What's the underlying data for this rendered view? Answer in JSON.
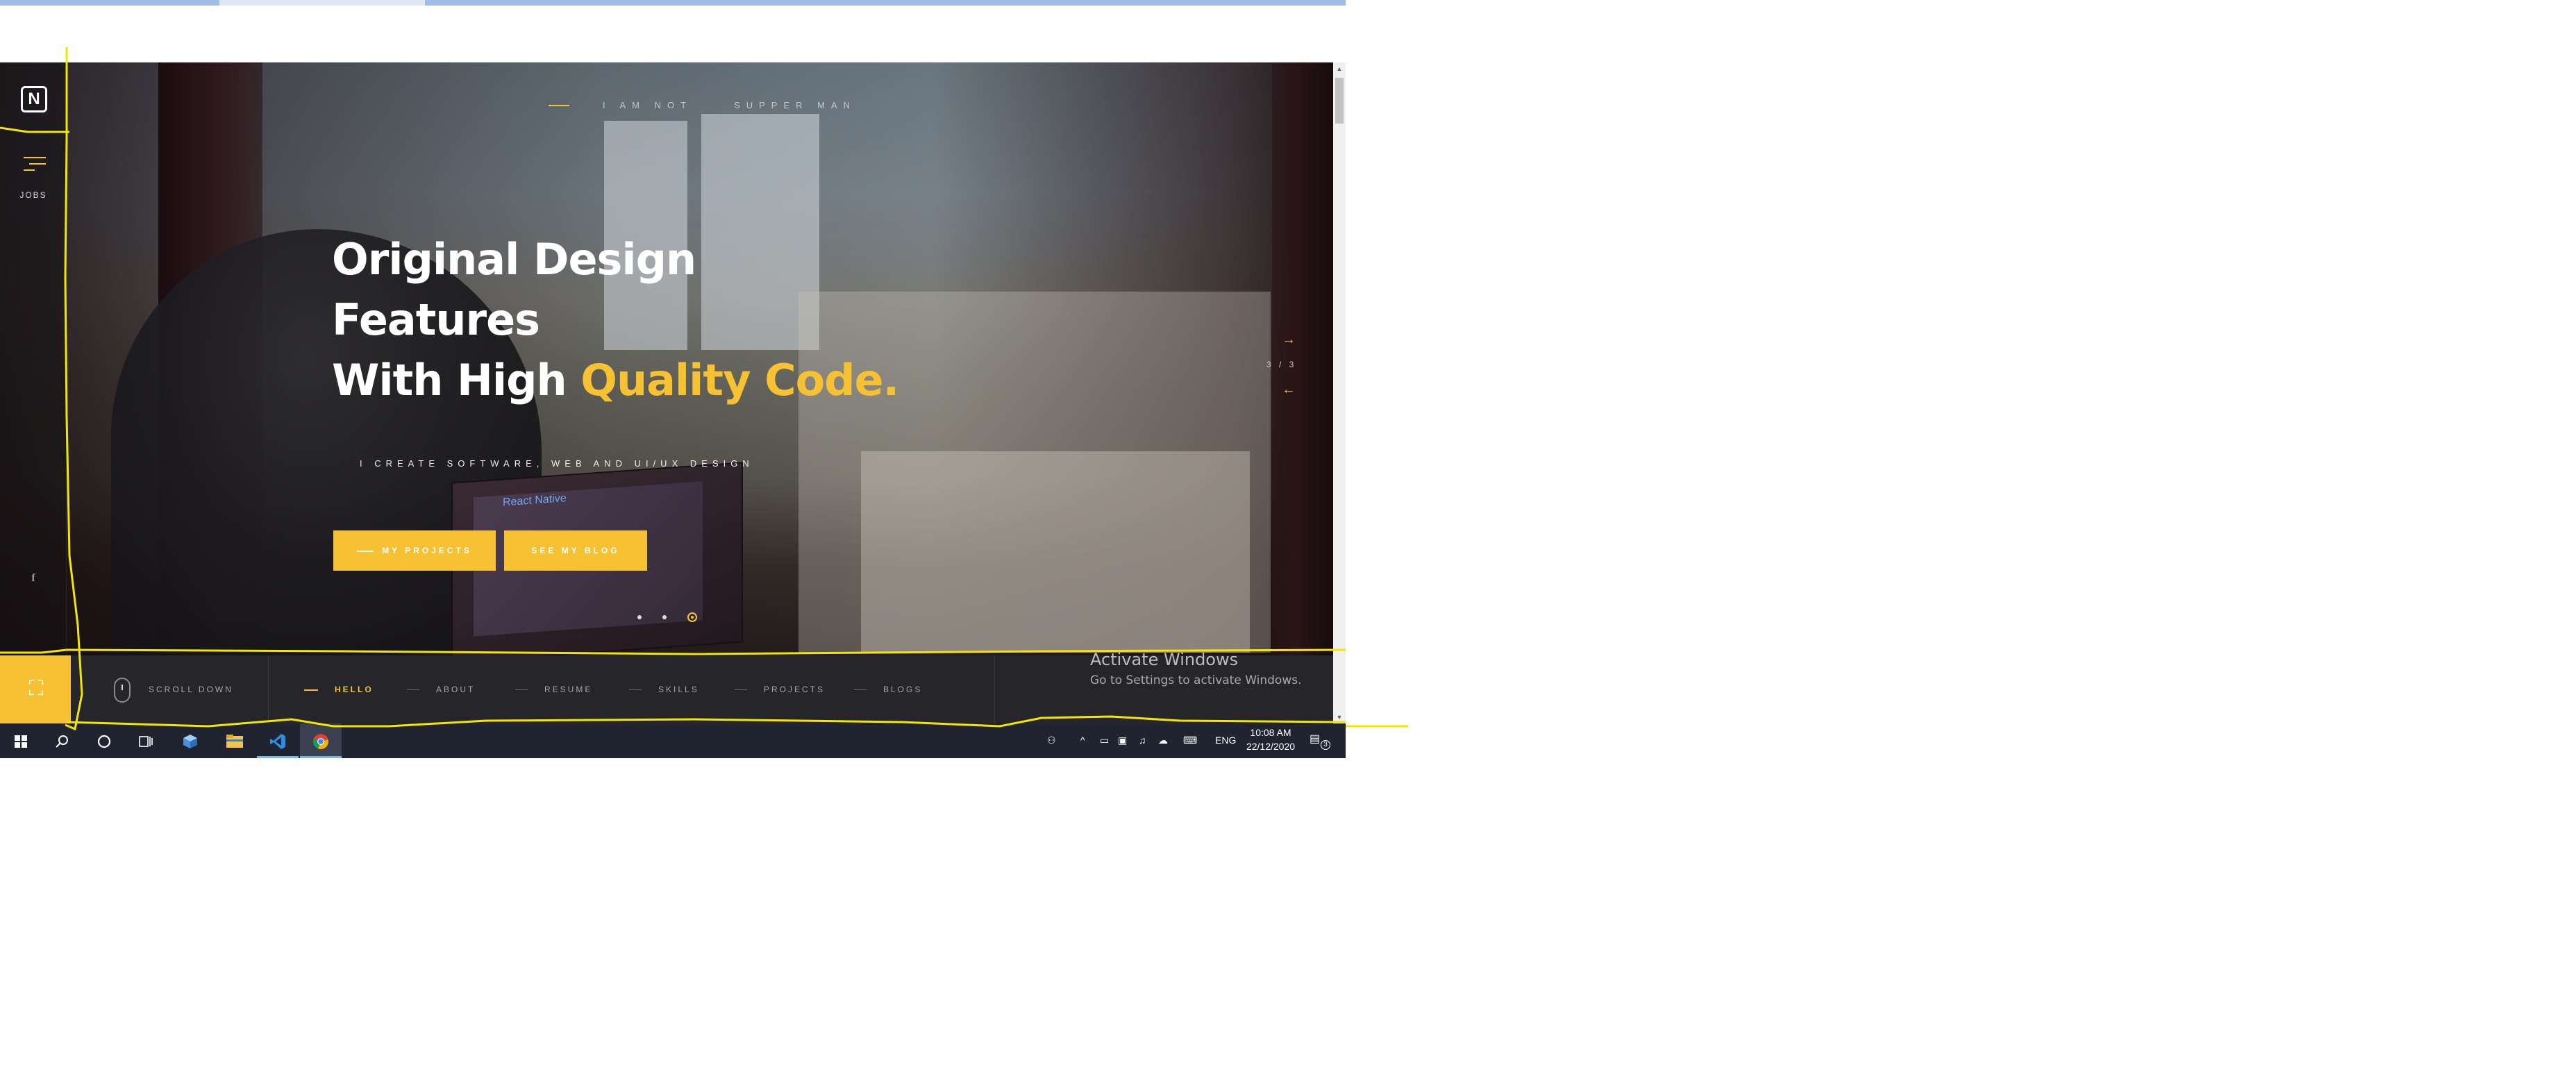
{
  "hero": {
    "tagline_left": "I AM NOT",
    "tagline_right": "SUPPER MAN",
    "headline_line1": "Original Design",
    "headline_line2": "Features",
    "headline_line3_prefix": "With High ",
    "headline_line3_accent": "Quality Code.",
    "subtitle": "I CREATE SOFTWARE, WEB AND UI/UX DESIGN",
    "primary_button": "MY PROJECTS",
    "secondary_button": "SEE MY BLOG",
    "slide_counter": "3 / 3",
    "laptop_screen_title": "React Native"
  },
  "sidebar": {
    "logo_letter": "N",
    "jobs_label": "JOBS",
    "social_icon": "f"
  },
  "bottom_nav": {
    "scroll_label": "SCROLL DOWN",
    "items": [
      {
        "label": "HELLO",
        "active": true
      },
      {
        "label": "ABOUT",
        "active": false
      },
      {
        "label": "RESUME",
        "active": false
      },
      {
        "label": "SKILLS",
        "active": false
      },
      {
        "label": "PROJECTS",
        "active": false
      },
      {
        "label": "BLOGS",
        "active": false
      }
    ]
  },
  "watermark": {
    "title": "Activate Windows",
    "subtitle": "Go to Settings to activate Windows."
  },
  "taskbar": {
    "language": "ENG",
    "time": "10:08 AM",
    "date": "22/12/2020",
    "notification_count": "3",
    "apps": [
      "windows-start",
      "search",
      "cortana",
      "task-view",
      "3d-box",
      "file-explorer",
      "vscode",
      "chrome"
    ]
  },
  "colors": {
    "accent": "#f6c234",
    "navbar_bg": "#26262a",
    "taskbar_bg": "#1f2430",
    "annotation": "#f3e600"
  }
}
